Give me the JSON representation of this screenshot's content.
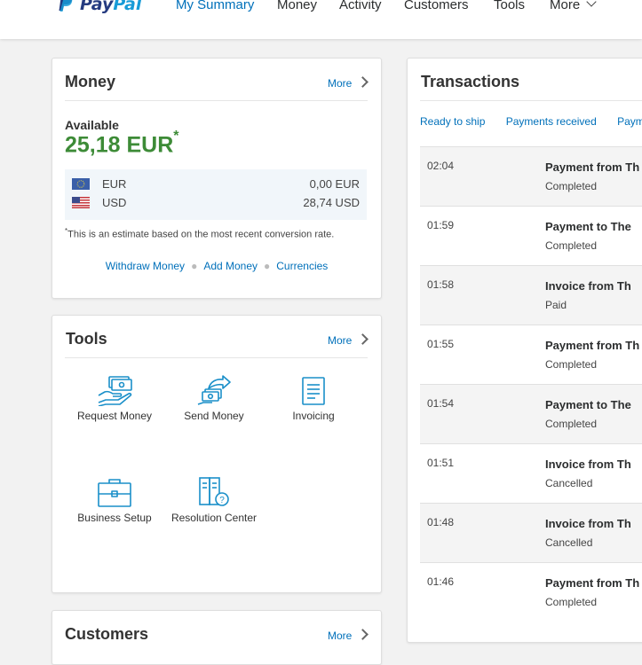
{
  "header": {
    "logo_pay": "Pay",
    "logo_pal": "Pal",
    "nav": [
      "My Summary",
      "Money",
      "Activity",
      "Customers",
      "Tools",
      "More"
    ]
  },
  "money": {
    "title": "Money",
    "more": "More",
    "available_label": "Available",
    "available_amount": "25,18 EUR",
    "asterisk": "*",
    "currencies": [
      {
        "code": "EUR",
        "value": "0,00 EUR",
        "flag": "eu-flag"
      },
      {
        "code": "USD",
        "value": "28,74 USD",
        "flag": "us-flag"
      }
    ],
    "note_mark": "*",
    "note": "This is an estimate based on the most recent conversion rate.",
    "links": [
      "Withdraw Money",
      "Add Money",
      "Currencies"
    ]
  },
  "tools": {
    "title": "Tools",
    "more": "More",
    "items": [
      "Request Money",
      "Send Money",
      "Invoicing",
      "Business Setup",
      "Resolution Center"
    ]
  },
  "customers": {
    "title": "Customers",
    "more": "More"
  },
  "transactions": {
    "title": "Transactions",
    "tabs": [
      "Ready to ship",
      "Payments received",
      "Paym"
    ],
    "rows": [
      {
        "time": "02:04",
        "title": "Payment from Th",
        "status": "Completed"
      },
      {
        "time": "01:59",
        "title": "Payment to The",
        "status": "Completed"
      },
      {
        "time": "01:58",
        "title": "Invoice from Th",
        "status": "Paid"
      },
      {
        "time": "01:55",
        "title": "Payment from Th",
        "status": "Completed"
      },
      {
        "time": "01:54",
        "title": "Payment to The",
        "status": "Completed"
      },
      {
        "time": "01:51",
        "title": "Invoice from Th",
        "status": "Cancelled"
      },
      {
        "time": "01:48",
        "title": "Invoice from Th",
        "status": "Cancelled"
      },
      {
        "time": "01:46",
        "title": "Payment from Th",
        "status": "Completed"
      }
    ]
  },
  "colors": {
    "accent": "#0070ba",
    "balance_green": "#3d8b37",
    "logo_dark": "#253b80",
    "logo_light": "#179bd7"
  }
}
